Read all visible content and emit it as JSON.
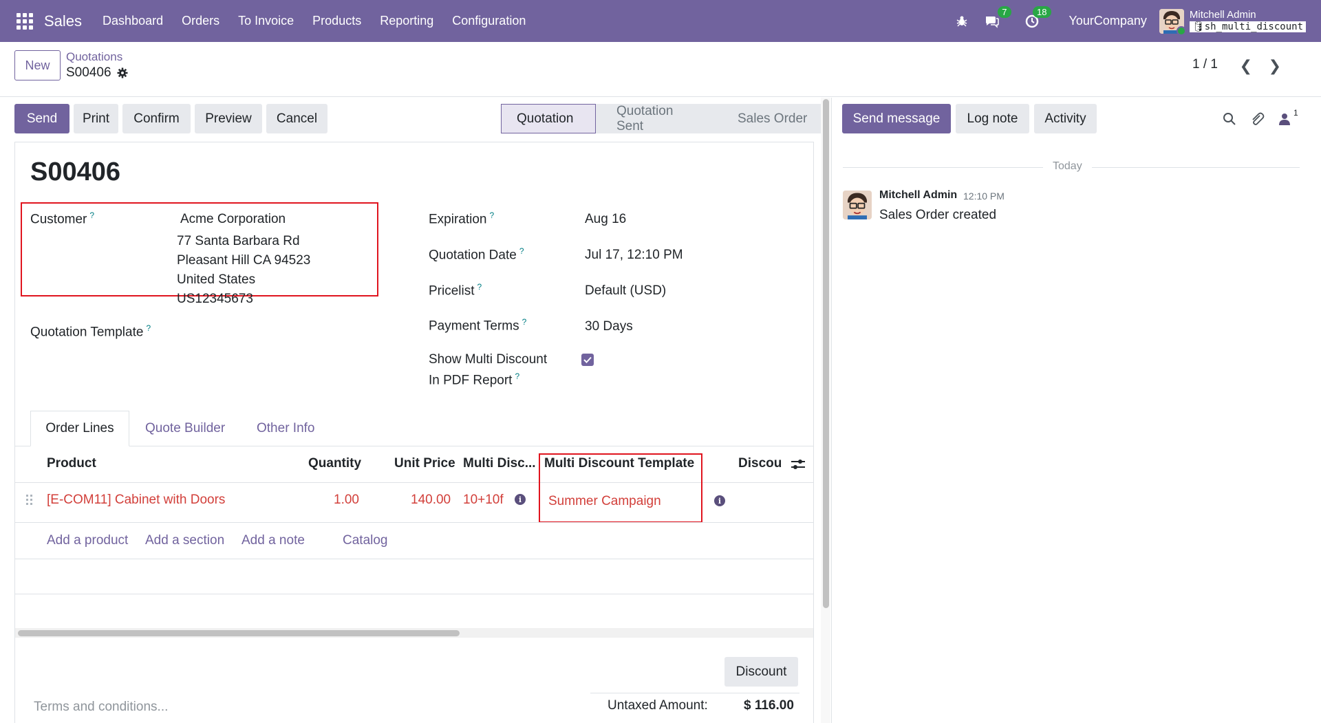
{
  "navbar": {
    "app_name": "Sales",
    "menu": [
      "Dashboard",
      "Orders",
      "To Invoice",
      "Products",
      "Reporting",
      "Configuration"
    ],
    "messages_count": "7",
    "activities_count": "18",
    "company": "YourCompany",
    "user_name": "Mitchell Admin",
    "database": "sh_multi_discount"
  },
  "control_panel": {
    "new_label": "New",
    "breadcrumb": "Quotations",
    "record_name": "S00406",
    "pager": "1 / 1"
  },
  "actions": {
    "send": "Send",
    "print": "Print",
    "confirm": "Confirm",
    "preview": "Preview",
    "cancel": "Cancel"
  },
  "statusbar": [
    "Quotation",
    "Quotation Sent",
    "Sales Order"
  ],
  "form": {
    "title": "S00406",
    "customer_label": "Customer",
    "customer_name": "Acme Corporation",
    "customer_address": [
      "77 Santa Barbara Rd",
      "Pleasant Hill CA 94523",
      "United States",
      "US12345673"
    ],
    "template_label": "Quotation Template",
    "expiration_label": "Expiration",
    "expiration_value": "Aug 16",
    "quotation_date_label": "Quotation Date",
    "quotation_date_value": "Jul 17, 12:10 PM",
    "pricelist_label": "Pricelist",
    "pricelist_value": "Default (USD)",
    "payment_terms_label": "Payment Terms",
    "payment_terms_value": "30 Days",
    "show_multi_label_1": "Show Multi Discount",
    "show_multi_label_2": "In PDF Report",
    "help_mark": "?"
  },
  "tabs": [
    "Order Lines",
    "Quote Builder",
    "Other Info"
  ],
  "order_lines": {
    "columns": [
      "Product",
      "Quantity",
      "Unit Price",
      "Multi Disc...",
      "Multi Discount Template",
      "Discour"
    ],
    "rows": [
      {
        "product": "[E-COM11] Cabinet with Doors",
        "quantity": "1.00",
        "unit_price": "140.00",
        "multi_disc": "10+10f",
        "template": "Summer Campaign"
      }
    ],
    "add_product": "Add a product",
    "add_section": "Add a section",
    "add_note": "Add a note",
    "catalog": "Catalog"
  },
  "footer": {
    "discount_button": "Discount",
    "terms_placeholder": "Terms and conditions...",
    "untaxed_label": "Untaxed Amount:",
    "untaxed_value": "$ 116.00"
  },
  "chatter": {
    "send_message": "Send message",
    "log_note": "Log note",
    "activity": "Activity",
    "followers_count": "1",
    "today": "Today",
    "message_author": "Mitchell Admin",
    "message_time": "12:10 PM",
    "message_body": "Sales Order created"
  },
  "colors": {
    "brand": "#71639e",
    "highlight_border": "#e0141e",
    "line_red": "#d23f3a",
    "badge_green": "#28a745"
  }
}
